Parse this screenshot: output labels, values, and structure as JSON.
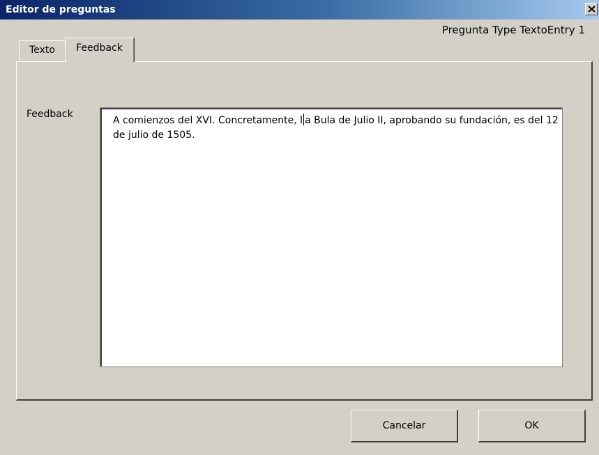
{
  "window": {
    "title": "Editor de preguntas"
  },
  "header": {
    "subtitle": "Pregunta Type TextoEntry 1"
  },
  "tabs": [
    {
      "label": "Texto",
      "active": false
    },
    {
      "label": "Feedback",
      "active": true
    }
  ],
  "feedback": {
    "label": "Feedback",
    "text_before_caret": "A comienzos del XVI. Concretamente, l",
    "text_after_caret": "a Bula de Julio II, aprobando su fundación, es del 12 de julio de 1505."
  },
  "buttons": {
    "cancel_label": "Cancelar",
    "ok_label": "OK"
  },
  "icons": {
    "close": "close-icon"
  },
  "colors": {
    "titlebar_start": "#0a246a",
    "titlebar_end": "#a6caf0",
    "window_bg": "#d4d0c8"
  }
}
